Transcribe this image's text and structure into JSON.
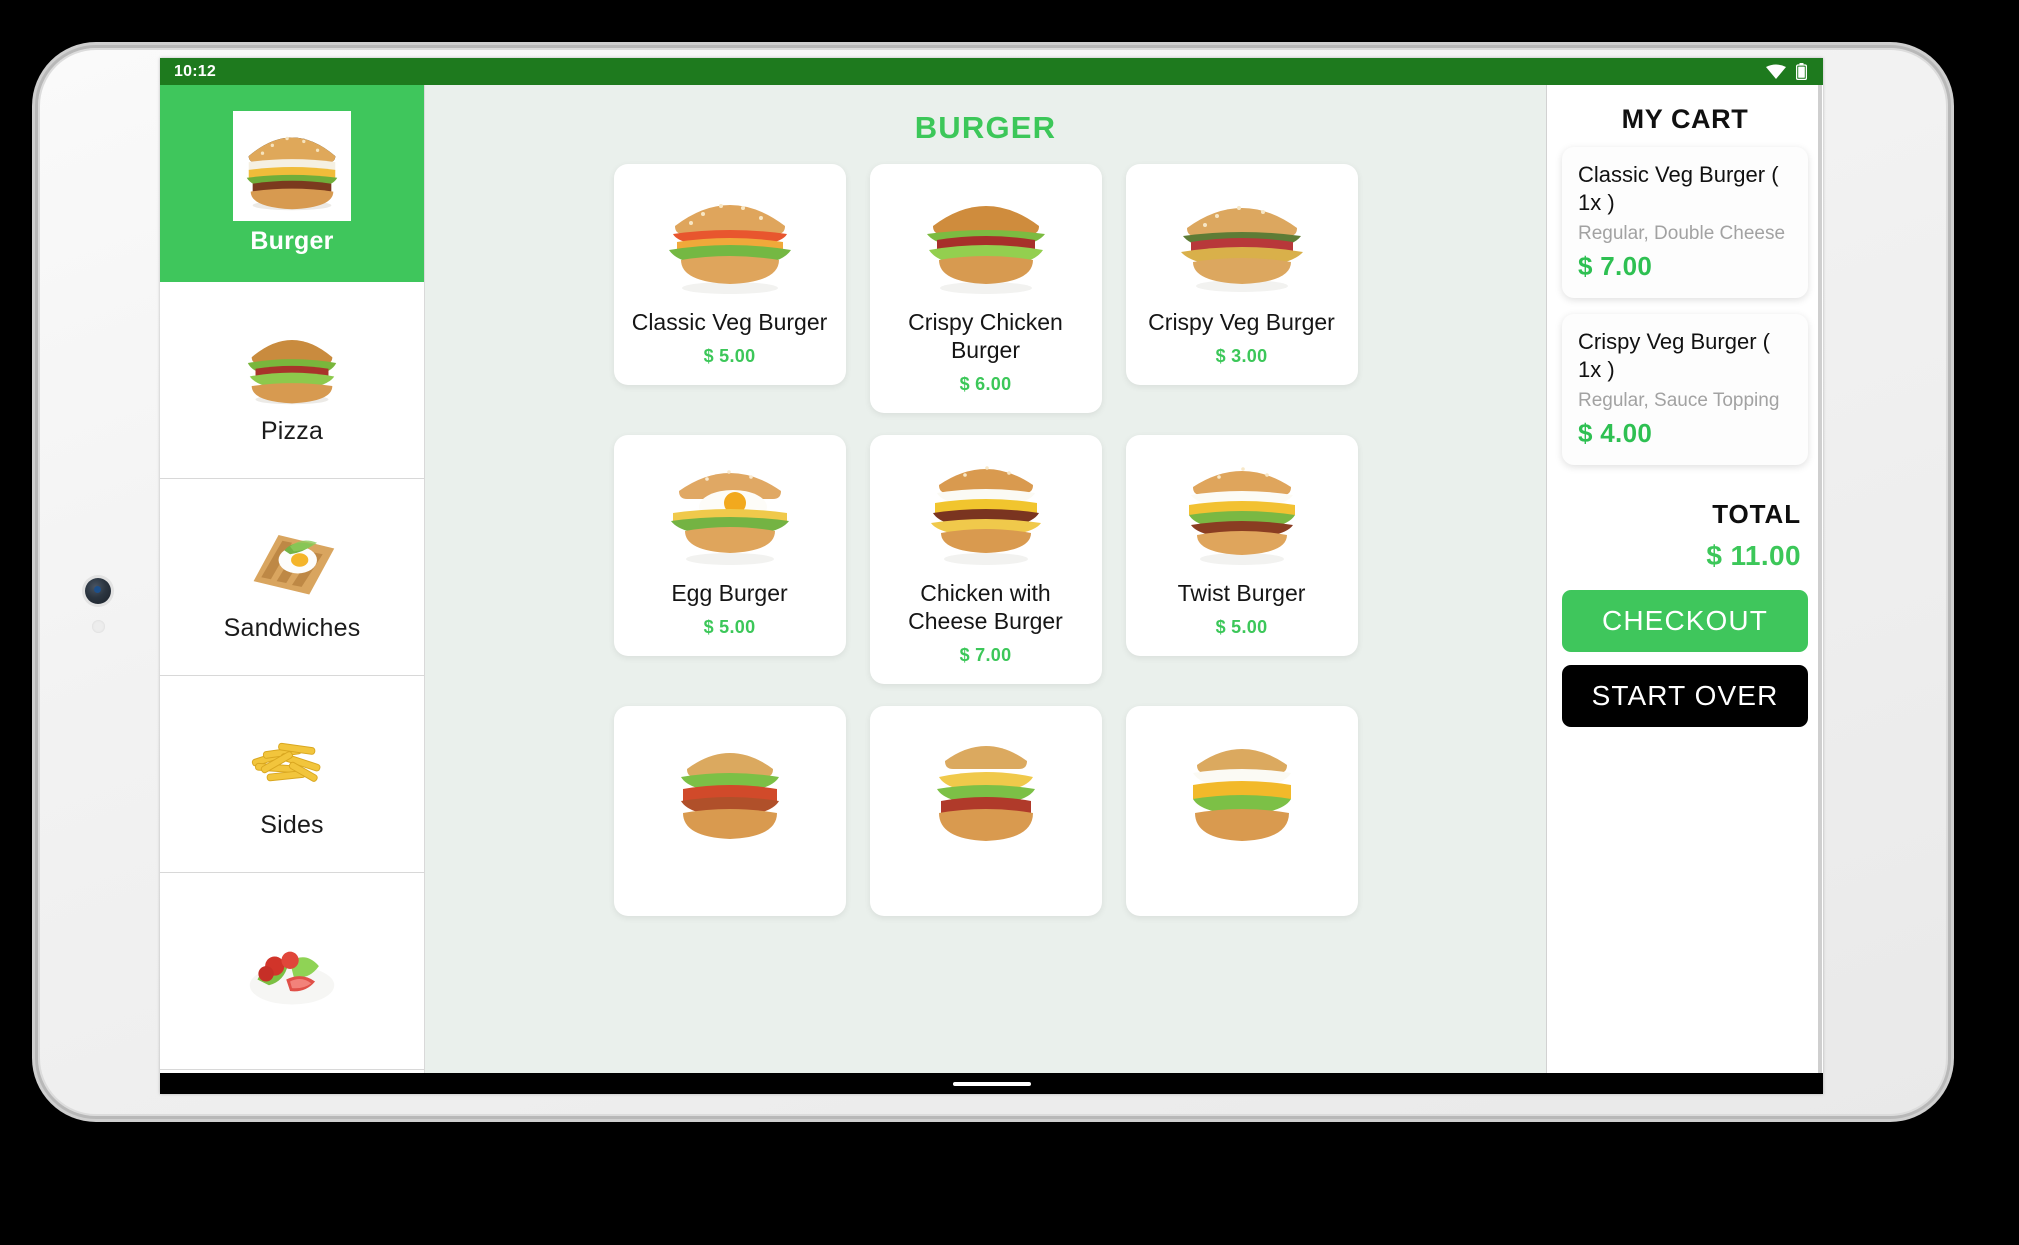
{
  "status_bar": {
    "time": "10:12",
    "icons": [
      "wifi-icon",
      "battery-icon"
    ]
  },
  "colors": {
    "status_bar_green": "#1e7a1e",
    "accent_green": "#3fc65c",
    "price_green": "#3cc759",
    "cart_price_green": "#2ec052",
    "menu_background": "#eaf0ec",
    "panel_white": "#ffffff",
    "start_over_black": "#000000",
    "muted_gray": "#a2a2a2"
  },
  "sidebar": {
    "items": [
      {
        "label": "Burger",
        "active": true,
        "image": "burger-photo"
      },
      {
        "label": "Pizza",
        "active": false,
        "image": "burger-photo"
      },
      {
        "label": "Sandwiches",
        "active": false,
        "image": "toast-egg-photo"
      },
      {
        "label": "Sides",
        "active": false,
        "image": "fries-photo"
      },
      {
        "label": "",
        "active": false,
        "image": "salad-photo"
      }
    ]
  },
  "menu": {
    "title": "BURGER",
    "products": [
      {
        "name": "Classic Veg Burger",
        "price": "$ 5.00",
        "image": "classic-veg-burger-photo"
      },
      {
        "name": "Crispy Chicken Burger",
        "price": "$ 6.00",
        "image": "crispy-chicken-burger-photo"
      },
      {
        "name": "Crispy Veg Burger",
        "price": "$ 3.00",
        "image": "crispy-veg-burger-photo"
      },
      {
        "name": "Egg Burger",
        "price": "$ 5.00",
        "image": "egg-burger-photo"
      },
      {
        "name": "Chicken with Cheese Burger",
        "price": "$ 7.00",
        "image": "chicken-cheese-burger-photo"
      },
      {
        "name": "Twist Burger",
        "price": "$ 5.00",
        "image": "twist-burger-photo"
      },
      {
        "name": "",
        "price": "",
        "image": "bacon-burger-photo"
      },
      {
        "name": "",
        "price": "",
        "image": "tall-veg-burger-photo"
      },
      {
        "name": "",
        "price": "",
        "image": "cheese-melt-burger-photo"
      }
    ]
  },
  "cart": {
    "title": "MY CART",
    "items": [
      {
        "name": "Classic Veg Burger ( 1x )",
        "options": "Regular, Double Cheese",
        "price": "$ 7.00"
      },
      {
        "name": "Crispy Veg Burger ( 1x )",
        "options": "Regular, Sauce Topping",
        "price": "$ 4.00"
      }
    ],
    "total_label": "TOTAL",
    "total_value": "$ 11.00",
    "checkout_label": "CHECKOUT",
    "start_over_label": "START OVER"
  }
}
